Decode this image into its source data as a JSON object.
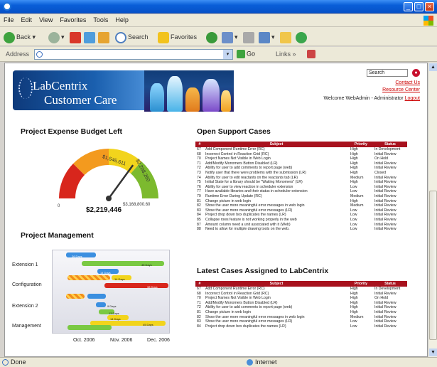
{
  "window": {
    "icon": "ie-icon"
  },
  "menu": [
    "File",
    "Edit",
    "View",
    "Favorites",
    "Tools",
    "Help"
  ],
  "toolbar": {
    "back": "Back",
    "search": "Search",
    "favorites": "Favorites"
  },
  "address": {
    "label": "Address",
    "go": "Go",
    "links": "Links"
  },
  "status": {
    "left": "Done",
    "zone": "Internet"
  },
  "banner": {
    "brand_line1": "LabCentrix",
    "brand_line2": "Customer Care"
  },
  "header": {
    "search_value": "Search",
    "contact": "Contact Us",
    "resource": "Resource Center",
    "welcome": "Welcome WebAdmin - Administrator",
    "logout": "Logout"
  },
  "gauge": {
    "title": "Project Expense Budget Left",
    "value_label": "$2,219,446",
    "min_label": "0",
    "max_label": "$3,168,800.60",
    "mark1": "$1,545,611",
    "mark2": "$2,208,260",
    "value": 2219446,
    "max": 3168800.6,
    "colors": {
      "red": "#d8261c",
      "orange": "#f39a1e",
      "yellow": "#f2d41c",
      "green": "#7cba2e"
    }
  },
  "gantt": {
    "title": "Project Management",
    "categories": [
      "Extension 1",
      "Configuration",
      "Extension 2",
      "Management"
    ],
    "x_ticks": [
      "Oct. 2006",
      "Nov. 2006",
      "Dec. 2006"
    ],
    "bar_labels": [
      "26 Days",
      "45 Days",
      "14 Days",
      "14 Days",
      "38 Days",
      "9 Days",
      "13 Days",
      "14 Days",
      "45 Days"
    ]
  },
  "support": {
    "title": "Open Support Cases",
    "columns": [
      "#",
      "Subject",
      "Priority",
      "Status"
    ],
    "rows": [
      [
        "67",
        "Add Component Runtime Error (RC)",
        "High",
        "In Development"
      ],
      [
        "68",
        "Incorrect Control in Reaction Grid (RC)",
        "High",
        "Initial Review"
      ],
      [
        "70",
        "Project Names Not Visible in Web Login",
        "High",
        "On Hold"
      ],
      [
        "71",
        "Add/Modify Monomers Button Disabled (LR)",
        "High",
        "Initial Review"
      ],
      [
        "72",
        "Ability for user to add comments to report page (web)",
        "High",
        "Initial Review"
      ],
      [
        "73",
        "Notify user that there were problems with the submission (LR)",
        "High",
        "Closed"
      ],
      [
        "74",
        "Ability for user to edit reactants on the reactants tab (LR)",
        "Medium",
        "Initial Review"
      ],
      [
        "75",
        "Initial State for a library should be \"Waiting Monomers\" (LR)",
        "High",
        "Initial Review"
      ],
      [
        "76",
        "Ability for user to view reaction in scheduler extension",
        "Low",
        "Initial Review"
      ],
      [
        "77",
        "Have available libraries and their status in scheduler extension",
        "Low",
        "Initial Review"
      ],
      [
        "79",
        "Runtime Error During Update (RC)",
        "Medium",
        "Initial Review"
      ],
      [
        "81",
        "Change picture in web login",
        "High",
        "Initial Review"
      ],
      [
        "82",
        "Show the user more meaningful error messages in web login",
        "Medium",
        "Initial Review"
      ],
      [
        "83",
        "Show the user more meaningful error messages (LR)",
        "Low",
        "Initial Review"
      ],
      [
        "84",
        "Project drop down box duplicates the names (LR)",
        "Low",
        "Initial Review"
      ],
      [
        "85",
        "Collapse rows feature is not working properly in the web",
        "Low",
        "Initial Review"
      ],
      [
        "87",
        "Amount column need a unit associated with it (Web)",
        "Low",
        "Initial Review"
      ],
      [
        "88",
        "Need to allow for multiple drawing tools on the web.",
        "Low",
        "Initial Review"
      ]
    ]
  },
  "latest": {
    "title": "Latest Cases Assigned to LabCentrix",
    "columns": [
      "#",
      "Subject",
      "Priority",
      "Status"
    ],
    "rows": [
      [
        "67",
        "Add Component Runtime Error (RC)",
        "High",
        "In Development"
      ],
      [
        "68",
        "Incorrect Control in Reaction Grid (RC)",
        "High",
        "Initial Review"
      ],
      [
        "70",
        "Project Names Not Visible in Web Login",
        "High",
        "On Hold"
      ],
      [
        "71",
        "Add/Modify Monomers Button Disabled (LR)",
        "High",
        "Initial Review"
      ],
      [
        "72",
        "Ability for user to add comments to report page (web)",
        "High",
        "Initial Review"
      ],
      [
        "81",
        "Change picture in web login",
        "High",
        "Initial Review"
      ],
      [
        "82",
        "Show the user more meaningful error messages in web login",
        "Medium",
        "Initial Review"
      ],
      [
        "83",
        "Show the user more meaningful error messages (LR)",
        "Low",
        "Initial Review"
      ],
      [
        "84",
        "Project drop down box duplicates the names (LR)",
        "Low",
        "Initial Review"
      ]
    ]
  }
}
